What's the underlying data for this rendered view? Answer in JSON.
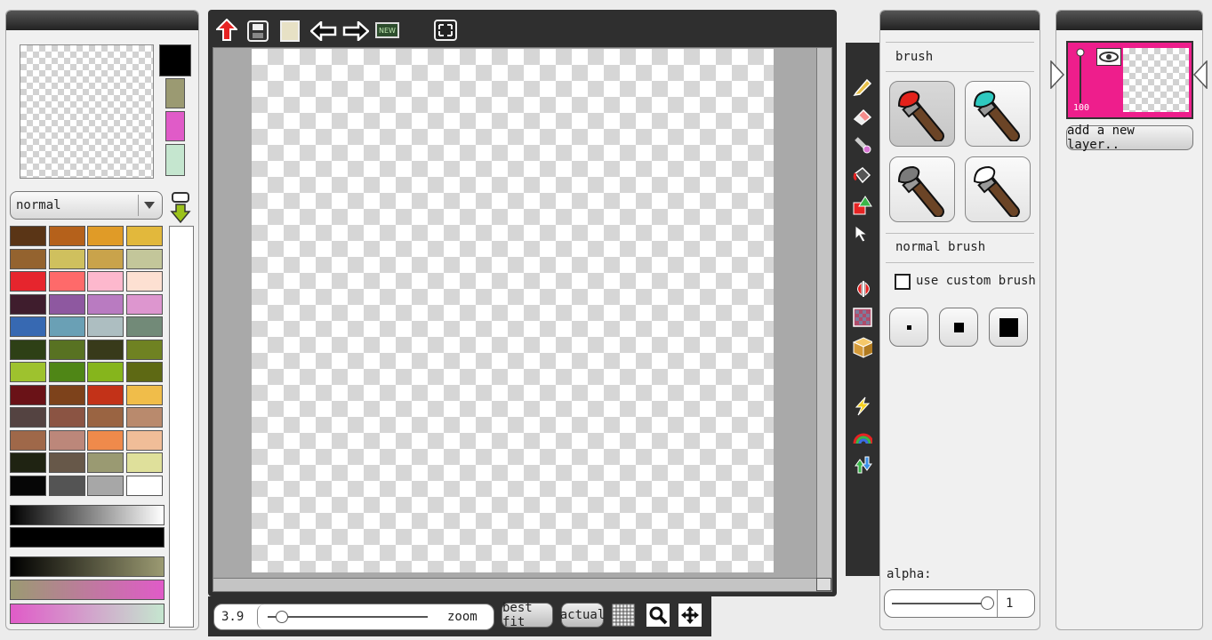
{
  "colors_panel": {
    "blend_mode": "normal",
    "current_colors": [
      "#000000",
      "#9b9a72",
      "#e05bc8",
      "#c5e6cf"
    ],
    "palette": [
      [
        "#5a3516",
        "#b5611b",
        "#e09b27",
        "#e2b83c"
      ],
      [
        "#94632f",
        "#cfc05e",
        "#c9a34b",
        "#c3c69a"
      ],
      [
        "#e6252d",
        "#fe6a6a",
        "#fdb8cd",
        "#fde0d2"
      ],
      [
        "#3f1d2d",
        "#8e58a0",
        "#b97bc1",
        "#dd96cf"
      ],
      [
        "#3769b2",
        "#6aa0b5",
        "#adbec1",
        "#728a78"
      ],
      [
        "#2e4016",
        "#587222",
        "#383a1a",
        "#6f8222"
      ],
      [
        "#9ec22e",
        "#4f8616",
        "#86b51c",
        "#5e6914"
      ],
      [
        "#6a1217",
        "#7d421b",
        "#c33218",
        "#f0bd4a"
      ],
      [
        "#544341",
        "#8b5443",
        "#9a6442",
        "#b98a6d"
      ],
      [
        "#9f6849",
        "#bc877a",
        "#ef8a4b",
        "#f0bd98"
      ],
      [
        "#1f2312",
        "#675849",
        "#9a9a72",
        "#dfe09b"
      ],
      [
        "#060606",
        "#545454",
        "#a7a7a7",
        "#ffffff"
      ]
    ],
    "gradients": [
      "linear-gradient(90deg,#000,#fff)",
      "linear-gradient(90deg,#000,#000)",
      "linear-gradient(90deg,#000,#9b9a72)",
      "linear-gradient(90deg,#9b9a72,#e05bc8)",
      "linear-gradient(90deg,#e05bc8,#c5e6cf)"
    ]
  },
  "toolbar": {
    "icons": [
      "upload-icon",
      "save-icon",
      "blank-page-icon",
      "undo-icon",
      "redo-icon",
      "new-icon",
      "fullscreen-icon"
    ],
    "new_label": "NEW"
  },
  "zoom_bar": {
    "zoom_value": "3.9",
    "zoom_label": "zoom",
    "best_fit": "best fit",
    "actual": "actual",
    "slider_position": 0.05
  },
  "tools": [
    "pencil",
    "eraser",
    "eyedropper",
    "bucket",
    "shape",
    "select",
    "mirror",
    "pattern",
    "3d-box",
    "lightning",
    "rainbow",
    "recycle"
  ],
  "brush_panel": {
    "title": "brush",
    "brushes": [
      "#e3221b",
      "#2ec9c0",
      "#7b7b7b",
      "#ffffff"
    ],
    "brush_name": "normal brush",
    "custom_brush_label": "use custom brush",
    "alpha_label": "alpha:",
    "alpha_value": "1"
  },
  "layers_panel": {
    "layer_opacity": "100",
    "add_layer_label": "add a new layer..",
    "layer_color": "#ee1e8c"
  }
}
